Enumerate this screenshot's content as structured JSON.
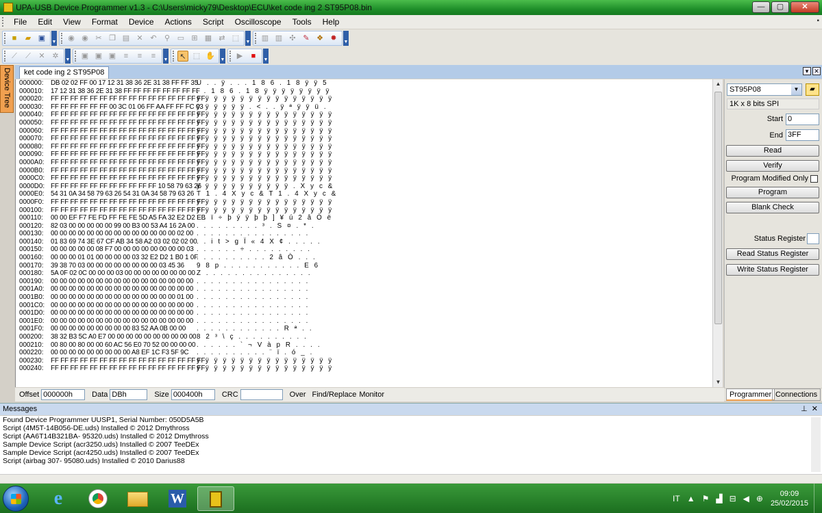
{
  "window": {
    "title": "UPA-USB Device Programmer v1.3 - C:\\Users\\micky79\\Desktop\\ECU\\ket code ing 2 ST95P08.bin",
    "minimize": "—",
    "maximize": "▢",
    "close": "✕"
  },
  "menu": [
    "File",
    "Edit",
    "View",
    "Format",
    "Device",
    "Actions",
    "Script",
    "Oscilloscope",
    "Tools",
    "Help"
  ],
  "side_tab": {
    "label": "Device Tree"
  },
  "doc_tab": {
    "label": "ket code ing 2 ST95P08"
  },
  "hex": {
    "rows": [
      {
        "o": "000000:",
        "h": "DB 02 02 FF 00 17 12 31 38 36 2E 31 38 FF FF 35",
        "a": "Û . . ÿ . . . 1 8 6 . 1 8 ÿ ÿ 5"
      },
      {
        "o": "000010:",
        "h": "17 12 31 38 36 2E 31 38 FF FF FF FF FF FF FF FF",
        "a": ". . 1 8 6 . 1 8 ÿ ÿ ÿ ÿ ÿ ÿ ÿ ÿ"
      },
      {
        "o": "000020:",
        "h": "FF FF FF FF FF FF FF FF FF FF FF FF FF FF FF FF",
        "a": "ÿ ÿ ÿ ÿ ÿ ÿ ÿ ÿ ÿ ÿ ÿ ÿ ÿ ÿ ÿ ÿ"
      },
      {
        "o": "000030:",
        "h": "FF FF FF FF FF FF 00 3C 01 06 FF AA FF FF FC 03",
        "a": "ÿ ÿ ÿ ÿ ÿ ÿ . < . . ÿ ª ÿ ÿ ü ."
      },
      {
        "o": "000040:",
        "h": "FF FF FF FF FF FF FF FF FF FF FF FF FF FF FF FF",
        "a": "ÿ ÿ ÿ ÿ ÿ ÿ ÿ ÿ ÿ ÿ ÿ ÿ ÿ ÿ ÿ ÿ"
      },
      {
        "o": "000050:",
        "h": "FF FF FF FF FF FF FF FF FF FF FF FF FF FF FF FF",
        "a": "ÿ ÿ ÿ ÿ ÿ ÿ ÿ ÿ ÿ ÿ ÿ ÿ ÿ ÿ ÿ ÿ"
      },
      {
        "o": "000060:",
        "h": "FF FF FF FF FF FF FF FF FF FF FF FF FF FF FF FF",
        "a": "ÿ ÿ ÿ ÿ ÿ ÿ ÿ ÿ ÿ ÿ ÿ ÿ ÿ ÿ ÿ ÿ"
      },
      {
        "o": "000070:",
        "h": "FF FF FF FF FF FF FF FF FF FF FF FF FF FF FF FF",
        "a": "ÿ ÿ ÿ ÿ ÿ ÿ ÿ ÿ ÿ ÿ ÿ ÿ ÿ ÿ ÿ ÿ"
      },
      {
        "o": "000080:",
        "h": "FF FF FF FF FF FF FF FF FF FF FF FF FF FF FF FF",
        "a": "ÿ ÿ ÿ ÿ ÿ ÿ ÿ ÿ ÿ ÿ ÿ ÿ ÿ ÿ ÿ ÿ"
      },
      {
        "o": "000090:",
        "h": "FF FF FF FF FF FF FF FF FF FF FF FF FF FF FF FF",
        "a": "ÿ ÿ ÿ ÿ ÿ ÿ ÿ ÿ ÿ ÿ ÿ ÿ ÿ ÿ ÿ ÿ"
      },
      {
        "o": "0000A0:",
        "h": "FF FF FF FF FF FF FF FF FF FF FF FF FF FF FF FF",
        "a": "ÿ ÿ ÿ ÿ ÿ ÿ ÿ ÿ ÿ ÿ ÿ ÿ ÿ ÿ ÿ ÿ"
      },
      {
        "o": "0000B0:",
        "h": "FF FF FF FF FF FF FF FF FF FF FF FF FF FF FF FF",
        "a": "ÿ ÿ ÿ ÿ ÿ ÿ ÿ ÿ ÿ ÿ ÿ ÿ ÿ ÿ ÿ ÿ"
      },
      {
        "o": "0000C0:",
        "h": "FF FF FF FF FF FF FF FF FF FF FF FF FF FF FF FF",
        "a": "ÿ ÿ ÿ ÿ ÿ ÿ ÿ ÿ ÿ ÿ ÿ ÿ ÿ ÿ ÿ ÿ"
      },
      {
        "o": "0000D0:",
        "h": "FF FF FF FF FF FF FF FF FF FF FF 10 58 79 63 26",
        "a": "ÿ ÿ ÿ ÿ ÿ ÿ ÿ ÿ ÿ ÿ ÿ . X y c &"
      },
      {
        "o": "0000E0:",
        "h": "54 31 0A 34 58 79 63 26 54 31 0A 34 58 79 63 26",
        "a": "T 1 . 4 X y c & T 1 . 4 X y c &"
      },
      {
        "o": "0000F0:",
        "h": "FF FF FF FF FF FF FF FF FF FF FF FF FF FF FF FF",
        "a": "ÿ ÿ ÿ ÿ ÿ ÿ ÿ ÿ ÿ ÿ ÿ ÿ ÿ ÿ ÿ ÿ"
      },
      {
        "o": "000100:",
        "h": "FF FF FF FF FF FF FF FF FF FF FF FF FF FF FF FF",
        "a": "ÿ ÿ ÿ ÿ ÿ ÿ ÿ ÿ ÿ ÿ ÿ ÿ ÿ ÿ ÿ ÿ"
      },
      {
        "o": "000110:",
        "h": "00 00 EF F7 FE FD FF FE FE 5D A5 FA 32 E2 D2 EB",
        "a": ". . ï ÷ þ ý ÿ þ þ ] ¥ ú 2 â Ò ë"
      },
      {
        "o": "000120:",
        "h": "82 03 00 00 00 00 00 99 00 B3 00 53 A4 16 2A 00",
        "a": ". . . . . . . . . ³ . S ¤ . * ."
      },
      {
        "o": "000130:",
        "h": "00 00 00 00 00 00 00 00 00 00 00 00 00 00 02 00",
        "a": ". . . . . . . . . . . . . . . ."
      },
      {
        "o": "000140:",
        "h": "01 83 69 74 3E 67 CF AB 34 58 A2 03 02 02 02 00",
        "a": ". . i t > g Ï « 4 X ¢ . . . . ."
      },
      {
        "o": "000150:",
        "h": "00 00 00 00 00 08 F7 00 00 00 00 00 00 00 00 03",
        "a": ". . . . . . ÷ . . . . . . . . ."
      },
      {
        "o": "000160:",
        "h": "00 00 00 01 01 00 00 00 00 03 32 E2 D2 1 B0 1 0F",
        "a": ". . . . . . . . . . 2 â Ò . . ."
      },
      {
        "o": "000170:",
        "h": "39 38 70 03 00 00 00 00 00 00 00 00 03 45 36",
        "a": "9 8 p . . . . . . . . . . . E 6"
      },
      {
        "o": "000180:",
        "h": "5A 0F 02 0C 00 00 00 03 00 00 00 00 00 00 00 00",
        "a": "Z . . . . . . . . . . . . . . ."
      },
      {
        "o": "000190:",
        "h": "00 00 00 00 00 00 00 00 00 00 00 00 00 00 00 00",
        "a": ". . . . . . . . . . . . . . . ."
      },
      {
        "o": "0001A0:",
        "h": "00 00 00 00 00 00 00 00 00 00 00 00 00 00 00 00",
        "a": ". . . . . . . . . . . . . . . ."
      },
      {
        "o": "0001B0:",
        "h": "00 00 00 00 00 00 00 00 00 00 00 00 00 00 01 00",
        "a": ". . . . . . . . . . . . . . . ."
      },
      {
        "o": "0001C0:",
        "h": "00 00 00 00 00 00 00 00 00 00 00 00 00 00 00 00",
        "a": ". . . . . . . . . . . . . . . ."
      },
      {
        "o": "0001D0:",
        "h": "00 00 00 00 00 00 00 00 00 00 00 00 00 00 00 00",
        "a": ". . . . . . . . . . . . . . . ."
      },
      {
        "o": "0001E0:",
        "h": "00 00 00 00 00 00 00 00 00 00 00 00 00 00 00 00",
        "a": ". . . . . . . . . . . . . . . ."
      },
      {
        "o": "0001F0:",
        "h": "00 00 00 00 00 00 00 00 00 83 52 AA 0B 00 00",
        "a": ". . . . . . . . . . . . R ª . ."
      },
      {
        "o": "000200:",
        "h": "38 32 B3 5C A0 E7 00 00 00 00 00 00 00 00 00 00",
        "a": "8 2 ³ \\   ç . . . . . . . . . ."
      },
      {
        "o": "000210:",
        "h": "00 80 00 80 00 00 60 AC 56 E0 70 52 00 00 00 00",
        "a": ". . . . . . ` ¬ V à p R . . . ."
      },
      {
        "o": "000220:",
        "h": "00 00 00 00 00 00 00 00 00 A8 EF 1C F3 5F 9C",
        "a": ". . . . . . . . . . ¨ ï . ó _ ."
      },
      {
        "o": "000230:",
        "h": "FF FF FF FF FF FF FF FF FF FF FF FF FF FF FF FF",
        "a": "ÿ ÿ ÿ ÿ ÿ ÿ ÿ ÿ ÿ ÿ ÿ ÿ ÿ ÿ ÿ ÿ"
      },
      {
        "o": "000240:",
        "h": "FF FF FF FF FF FF FF FF FF FF FF FF FF FF FF FF",
        "a": "ÿ ÿ ÿ ÿ ÿ ÿ ÿ ÿ ÿ ÿ ÿ ÿ ÿ ÿ ÿ ÿ"
      }
    ]
  },
  "status": {
    "offset_label": "Offset",
    "offset_value": "000000h",
    "data_label": "Data",
    "data_value": "DBh",
    "size_label": "Size",
    "size_value": "000400h",
    "crc_label": "CRC",
    "crc_value": "",
    "over_label": "Over",
    "find_label": "Find/Replace",
    "monitor_label": "Monitor"
  },
  "programmer": {
    "device": "ST95P08",
    "device_desc": "1K x 8 bits SPI",
    "start_label": "Start",
    "start_value": "0",
    "end_label": "End",
    "end_value": "3FF",
    "read": "Read",
    "verify": "Verify",
    "program_modified_only": "Program Modified Only",
    "program": "Program",
    "blank_check": "Blank Check",
    "status_register_label": "Status Register",
    "read_status_register": "Read Status Register",
    "write_status_register": "Write Status Register",
    "tabs": [
      "Programmer",
      "Connections"
    ]
  },
  "messages": {
    "title": "Messages",
    "lines": [
      "Found Device Programmer UUSP1, Serial Number: 050D5A5B",
      "Script (4M5T-14B056-DE.uds) Installed © 2012 Dmythross",
      "Script (AA6T14B321BA- 95320.uds) Installed © 2012 Dmythross",
      "Sample Device Script (acr3250.uds) Installed © 2007 TeeDEx",
      "Sample Device Script (acr4250.uds) Installed © 2007 TeeDEx",
      "Script (airbag 307- 95080.uds) Installed © 2010 Darius88"
    ]
  },
  "taskbar": {
    "language": "IT",
    "time": "09:09",
    "date": "25/02/2015",
    "word_label": "W"
  }
}
